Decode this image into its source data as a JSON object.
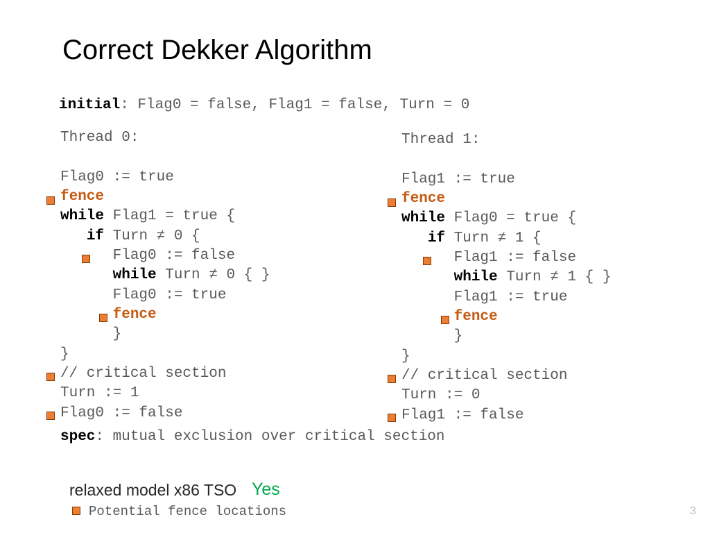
{
  "title": "Correct Dekker Algorithm",
  "initial_kw": "initial",
  "initial_rest": ": Flag0 = false, Flag1 = false, Turn = 0",
  "t0": {
    "header": "Thread 0:",
    "l1": "Flag0 := true",
    "l2": "fence",
    "l3a": "while",
    "l3b": " Flag1 = true {",
    "l4a": "if",
    "l4b": " Turn ≠ 0 {",
    "l5": "Flag0 := false",
    "l6a": "while",
    "l6b": " Turn ≠ 0 { }",
    "l7": "Flag0 := true",
    "l8": "fence",
    "l9": "}",
    "l10": "}",
    "l11": "// critical section",
    "l12": "Turn := 1",
    "l13": "Flag0 := false"
  },
  "t1": {
    "header": "Thread 1:",
    "l1": "Flag1 := true",
    "l2": "fence",
    "l3a": "while",
    "l3b": " Flag0 = true {",
    "l4a": "if",
    "l4b": " Turn ≠ 1 {",
    "l5": "Flag1 := false",
    "l6a": "while",
    "l6b": " Turn ≠ 1 { }",
    "l7": "Flag1 := true",
    "l8": "fence",
    "l9": "}",
    "l10": "}",
    "l11": "// critical section",
    "l12": "Turn := 0",
    "l13": "Flag1 := false"
  },
  "spec_kw": "spec",
  "spec_rest": ": mutual exclusion over critical section",
  "relaxed": "relaxed model x86 TSO",
  "yes": "Yes",
  "legend": "Potential fence locations",
  "pagenum": "3"
}
